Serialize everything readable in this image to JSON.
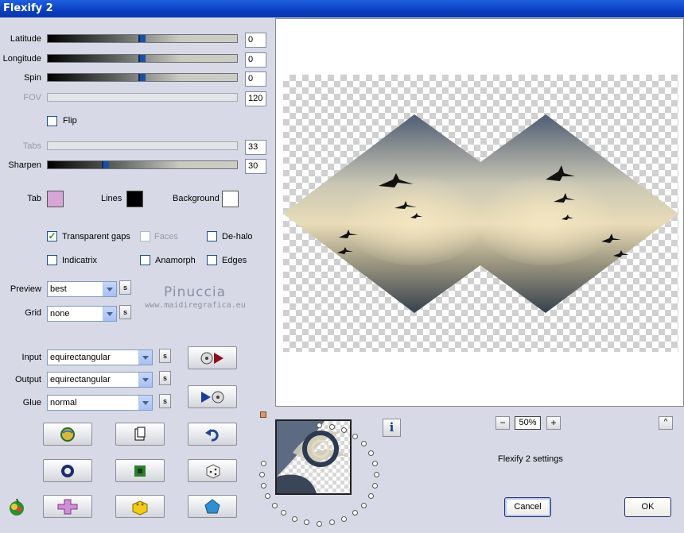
{
  "window": {
    "title": "Flexify 2"
  },
  "sliders": [
    {
      "label": "Latitude",
      "value": "0",
      "disabled": false,
      "level": 0.5
    },
    {
      "label": "Longitude",
      "value": "0",
      "disabled": false,
      "level": 0.5
    },
    {
      "label": "Spin",
      "value": "0",
      "disabled": false,
      "level": 0.5
    },
    {
      "label": "FOV",
      "value": "120",
      "disabled": true
    },
    {
      "label": "Tabs",
      "value": "33",
      "disabled": true
    },
    {
      "label": "Sharpen",
      "value": "30",
      "disabled": false,
      "level": 0.3
    }
  ],
  "flip": {
    "label": "Flip",
    "checked": false
  },
  "colors": {
    "tab": {
      "label": "Tab",
      "color": "#d6a6d6"
    },
    "lines": {
      "label": "Lines",
      "color": "#000000"
    },
    "background": {
      "label": "Background",
      "color": "#ffffff"
    }
  },
  "options": {
    "transparent_gaps": {
      "label": "Transparent gaps",
      "checked": true
    },
    "faces": {
      "label": "Faces",
      "checked": false,
      "disabled": true
    },
    "de_halo": {
      "label": "De-halo",
      "checked": false
    },
    "indicatrix": {
      "label": "Indicatrix",
      "checked": false
    },
    "anamorph": {
      "label": "Anamorph",
      "checked": false
    },
    "edges": {
      "label": "Edges",
      "checked": false
    }
  },
  "preview_select": {
    "label": "Preview",
    "value": "best",
    "s": "s"
  },
  "grid_select": {
    "label": "Grid",
    "value": "none",
    "s": "s"
  },
  "watermark": {
    "line1": "Pinuccia",
    "line2": "www.maidiregrafica.eu"
  },
  "input_select": {
    "label": "Input",
    "value": "equirectangular",
    "s": "s"
  },
  "output_select": {
    "label": "Output",
    "value": "equirectangular",
    "s": "s"
  },
  "glue_select": {
    "label": "Glue",
    "value": "normal",
    "s": "s"
  },
  "zoom": {
    "minus": "−",
    "value": "50%",
    "plus": "+"
  },
  "settings_label": "Flexify 2 settings",
  "buttons": {
    "cancel": "Cancel",
    "ok": "OK",
    "info": "i",
    "up": "^"
  },
  "accent": {
    "title_bar": "#0a3fbe",
    "checkmark": "#21a121"
  }
}
